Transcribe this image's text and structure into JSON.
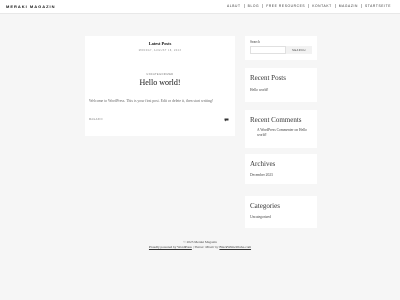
{
  "header": {
    "brand": "MERAKI MAGAZIN",
    "nav": [
      "ALBUT",
      "BLOG",
      "FREE RESOURCES",
      "KONTAKT",
      "MAGAZIN",
      "STARTSEITE"
    ]
  },
  "main": {
    "latest_title": "Latest Posts",
    "post_meta": "MONDAY, AUGUST 18, 2023",
    "post_category": "UNCATEGORIZED",
    "post_title": "Hello world!",
    "post_excerpt": "Welcome to WordPress. This is your first post. Edit or delete it, then start writing!",
    "post_author": "MAGAZIN",
    "icons": {
      "comment": "comment-icon"
    }
  },
  "sidebar": {
    "search": {
      "label": "Search",
      "button": "SEARCH",
      "placeholder": ""
    },
    "recent_posts": {
      "title": "Recent Posts",
      "items": [
        "Hello world!"
      ]
    },
    "recent_comments": {
      "title": "Recent Comments",
      "items": [
        "A WordPress Commenter on Hello world!"
      ]
    },
    "archives": {
      "title": "Archives",
      "items": [
        "December 2023"
      ]
    },
    "categories": {
      "title": "Categories",
      "items": [
        "Uncategorized"
      ]
    }
  },
  "footer": {
    "copyright": "© 2023 Meraki Magazin",
    "powered": "Proudly powered by WordPress",
    "theme": "Theme: Minetr by",
    "theme_author": "BlackWhiteWorks.com"
  },
  "colors": {
    "background": "#f6f6f6",
    "card": "#ffffff",
    "text": "#222222"
  }
}
